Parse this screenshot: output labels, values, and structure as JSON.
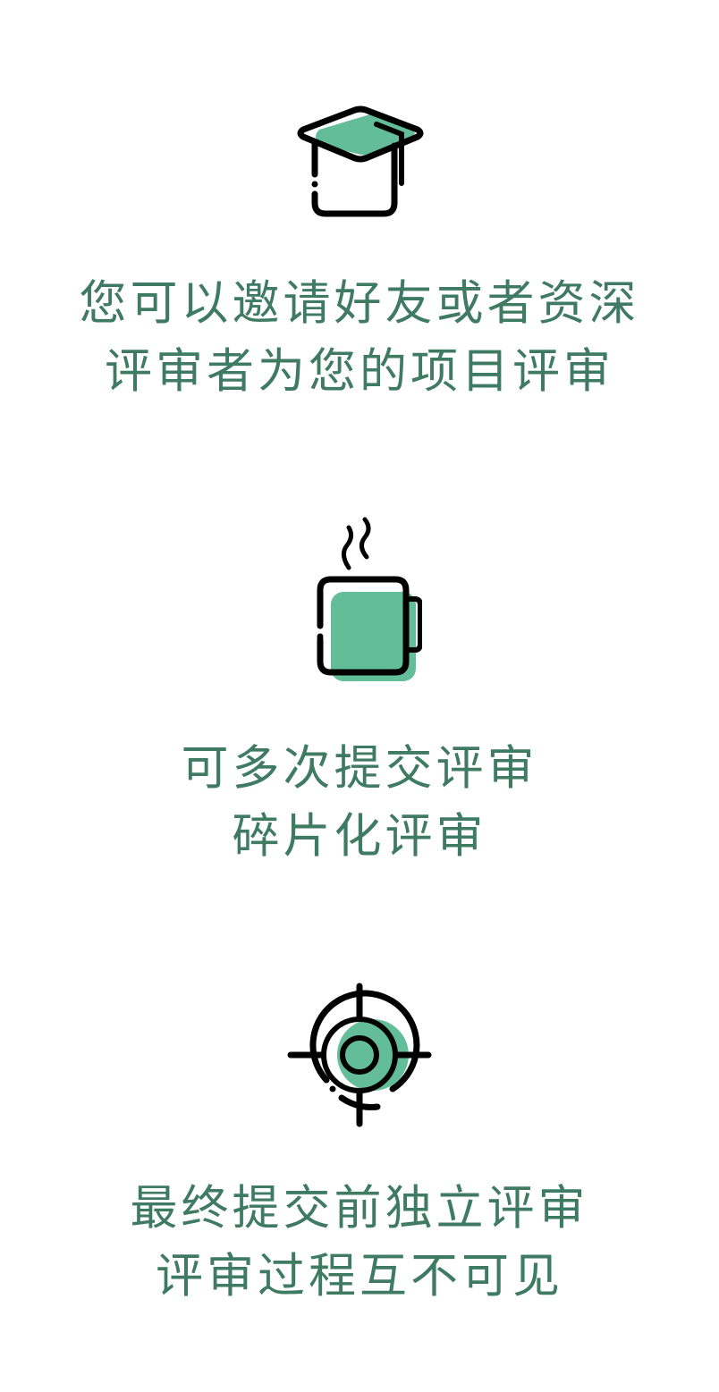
{
  "accent_color": "#63bd99",
  "text_color": "#3f7a63",
  "features": [
    {
      "icon": "graduation-cap-icon",
      "lines": [
        "您可以邀请好友或者资深",
        "评审者为您的项目评审"
      ]
    },
    {
      "icon": "coffee-mug-icon",
      "lines": [
        "可多次提交评审",
        "碎片化评审"
      ]
    },
    {
      "icon": "target-crosshair-icon",
      "lines": [
        "最终提交前独立评审",
        "评审过程互不可见"
      ]
    }
  ]
}
